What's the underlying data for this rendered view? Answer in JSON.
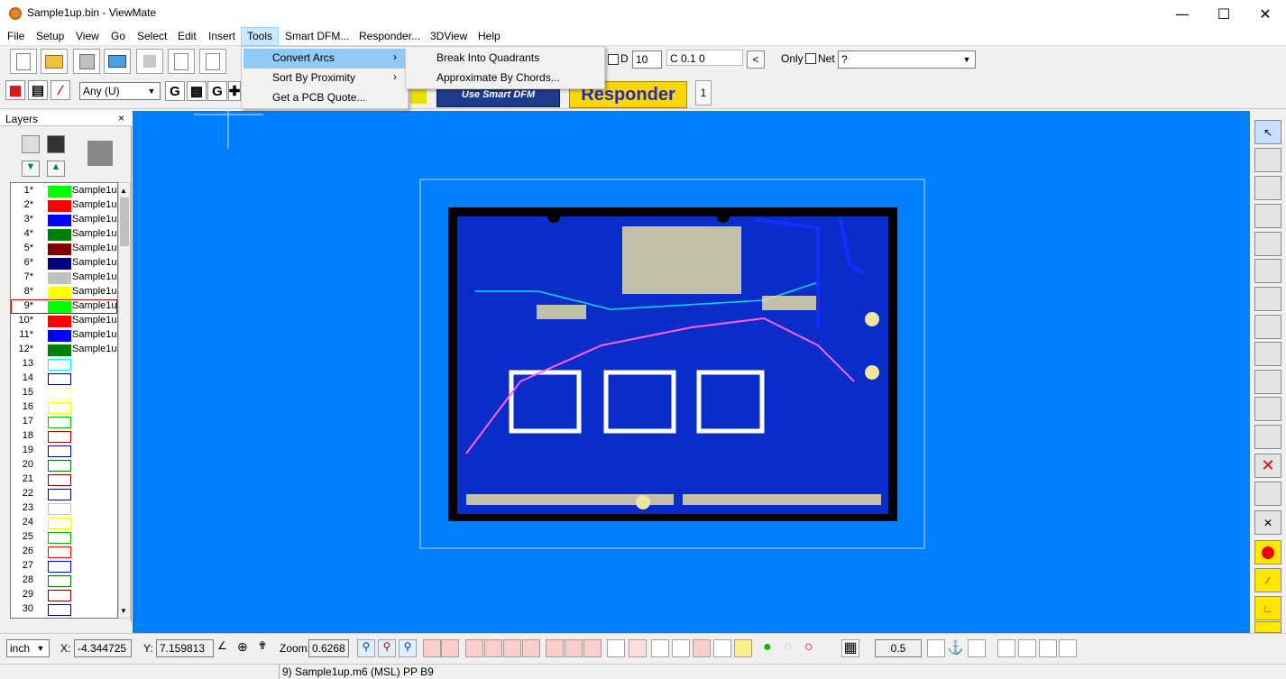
{
  "window": {
    "title": "Sample1up.bin - ViewMate"
  },
  "menu": [
    "File",
    "Setup",
    "View",
    "Go",
    "Select",
    "Edit",
    "Insert",
    "Tools",
    "Smart DFM...",
    "Responder...",
    "3DView",
    "Help"
  ],
  "tools_menu": {
    "items": [
      "Convert Arcs",
      "Sort By Proximity",
      "Get a PCB Quote..."
    ]
  },
  "convert_arcs_submenu": {
    "items": [
      "Break Into Quadrants",
      "Approximate By Chords..."
    ]
  },
  "toolbar": {
    "d_label": "D",
    "d_value": "10",
    "c_value": "C 0.1  0",
    "only_label": "Only",
    "net_label": "Net",
    "net_value": "?",
    "filter_value": "Any    (U)",
    "smart_dfm_label": "Use Smart DFM",
    "responder_label": "Responder",
    "page_num": "1"
  },
  "layers": {
    "title": "Layers",
    "rows": [
      {
        "num": "1*",
        "color": "#00ff00",
        "name": "Sample1u",
        "filled": true
      },
      {
        "num": "2*",
        "color": "#ff0000",
        "name": "Sample1u",
        "filled": true
      },
      {
        "num": "3*",
        "color": "#0000ff",
        "name": "Sample1u",
        "filled": true
      },
      {
        "num": "4*",
        "color": "#008000",
        "name": "Sample1u",
        "filled": true
      },
      {
        "num": "5*",
        "color": "#800000",
        "name": "Sample1u",
        "filled": true
      },
      {
        "num": "6*",
        "color": "#000080",
        "name": "Sample1u",
        "filled": true
      },
      {
        "num": "7*",
        "color": "#c0c0c0",
        "name": "Sample1u",
        "filled": true
      },
      {
        "num": "8*",
        "color": "#ffff00",
        "name": "Sample1u",
        "filled": true
      },
      {
        "num": "9*",
        "color": "#00ff00",
        "name": "Sample1u",
        "filled": true,
        "selected": true
      },
      {
        "num": "10*",
        "color": "#ff0000",
        "name": "Sample1u",
        "filled": true
      },
      {
        "num": "11*",
        "color": "#0000ff",
        "name": "Sample1u",
        "filled": true
      },
      {
        "num": "12*",
        "color": "#008000",
        "name": "Sample1u",
        "filled": true
      },
      {
        "num": "13",
        "color": "#00ffff",
        "name": "",
        "filled": false
      },
      {
        "num": "14",
        "color": "#000080",
        "name": "",
        "filled": false
      },
      {
        "num": "15",
        "color": "#ffffc0",
        "name": "",
        "filled": false
      },
      {
        "num": "16",
        "color": "#ffff00",
        "name": "",
        "filled": false
      },
      {
        "num": "17",
        "color": "#00c000",
        "name": "",
        "filled": false
      },
      {
        "num": "18",
        "color": "#c00000",
        "name": "",
        "filled": false
      },
      {
        "num": "19",
        "color": "#0000c0",
        "name": "",
        "filled": false
      },
      {
        "num": "20",
        "color": "#008000",
        "name": "",
        "filled": false
      },
      {
        "num": "21",
        "color": "#800000",
        "name": "",
        "filled": false
      },
      {
        "num": "22",
        "color": "#000080",
        "name": "",
        "filled": false
      },
      {
        "num": "23",
        "color": "#c0c0c0",
        "name": "",
        "filled": false
      },
      {
        "num": "24",
        "color": "#ffff00",
        "name": "",
        "filled": false
      },
      {
        "num": "25",
        "color": "#00c000",
        "name": "",
        "filled": false
      },
      {
        "num": "26",
        "color": "#ff0000",
        "name": "",
        "filled": false
      },
      {
        "num": "27",
        "color": "#0000ff",
        "name": "",
        "filled": false
      },
      {
        "num": "28",
        "color": "#008000",
        "name": "",
        "filled": false
      },
      {
        "num": "29",
        "color": "#800000",
        "name": "",
        "filled": false
      },
      {
        "num": "30",
        "color": "#000080",
        "name": "",
        "filled": false
      }
    ]
  },
  "bottom": {
    "units": "inch",
    "x_label": "X:",
    "x_value": "-4.344725",
    "y_label": "Y:",
    "y_value": "7.159813",
    "zoom_label": "Zoom:",
    "zoom_value": "0.6268",
    "snap_value": "0.5"
  },
  "status": {
    "text": "9) Sample1up.m6 (MSL) PP B9"
  },
  "colors": {
    "canvas_bg": "#0080ff",
    "board_frame": "#000000",
    "board_inner": "#0a2cc8"
  }
}
